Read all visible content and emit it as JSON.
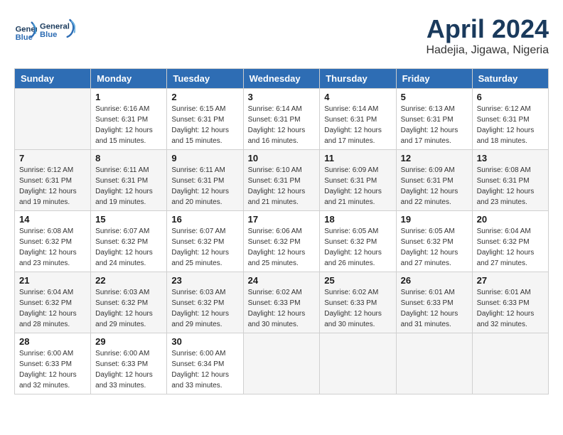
{
  "header": {
    "logo_line1": "General",
    "logo_line2": "Blue",
    "month": "April 2024",
    "location": "Hadejia, Jigawa, Nigeria"
  },
  "days_of_week": [
    "Sunday",
    "Monday",
    "Tuesday",
    "Wednesday",
    "Thursday",
    "Friday",
    "Saturday"
  ],
  "weeks": [
    [
      {
        "day": "",
        "sunrise": "",
        "sunset": "",
        "daylight": ""
      },
      {
        "day": "1",
        "sunrise": "Sunrise: 6:16 AM",
        "sunset": "Sunset: 6:31 PM",
        "daylight": "Daylight: 12 hours and 15 minutes."
      },
      {
        "day": "2",
        "sunrise": "Sunrise: 6:15 AM",
        "sunset": "Sunset: 6:31 PM",
        "daylight": "Daylight: 12 hours and 15 minutes."
      },
      {
        "day": "3",
        "sunrise": "Sunrise: 6:14 AM",
        "sunset": "Sunset: 6:31 PM",
        "daylight": "Daylight: 12 hours and 16 minutes."
      },
      {
        "day": "4",
        "sunrise": "Sunrise: 6:14 AM",
        "sunset": "Sunset: 6:31 PM",
        "daylight": "Daylight: 12 hours and 17 minutes."
      },
      {
        "day": "5",
        "sunrise": "Sunrise: 6:13 AM",
        "sunset": "Sunset: 6:31 PM",
        "daylight": "Daylight: 12 hours and 17 minutes."
      },
      {
        "day": "6",
        "sunrise": "Sunrise: 6:12 AM",
        "sunset": "Sunset: 6:31 PM",
        "daylight": "Daylight: 12 hours and 18 minutes."
      }
    ],
    [
      {
        "day": "7",
        "sunrise": "Sunrise: 6:12 AM",
        "sunset": "Sunset: 6:31 PM",
        "daylight": "Daylight: 12 hours and 19 minutes."
      },
      {
        "day": "8",
        "sunrise": "Sunrise: 6:11 AM",
        "sunset": "Sunset: 6:31 PM",
        "daylight": "Daylight: 12 hours and 19 minutes."
      },
      {
        "day": "9",
        "sunrise": "Sunrise: 6:11 AM",
        "sunset": "Sunset: 6:31 PM",
        "daylight": "Daylight: 12 hours and 20 minutes."
      },
      {
        "day": "10",
        "sunrise": "Sunrise: 6:10 AM",
        "sunset": "Sunset: 6:31 PM",
        "daylight": "Daylight: 12 hours and 21 minutes."
      },
      {
        "day": "11",
        "sunrise": "Sunrise: 6:09 AM",
        "sunset": "Sunset: 6:31 PM",
        "daylight": "Daylight: 12 hours and 21 minutes."
      },
      {
        "day": "12",
        "sunrise": "Sunrise: 6:09 AM",
        "sunset": "Sunset: 6:31 PM",
        "daylight": "Daylight: 12 hours and 22 minutes."
      },
      {
        "day": "13",
        "sunrise": "Sunrise: 6:08 AM",
        "sunset": "Sunset: 6:31 PM",
        "daylight": "Daylight: 12 hours and 23 minutes."
      }
    ],
    [
      {
        "day": "14",
        "sunrise": "Sunrise: 6:08 AM",
        "sunset": "Sunset: 6:32 PM",
        "daylight": "Daylight: 12 hours and 23 minutes."
      },
      {
        "day": "15",
        "sunrise": "Sunrise: 6:07 AM",
        "sunset": "Sunset: 6:32 PM",
        "daylight": "Daylight: 12 hours and 24 minutes."
      },
      {
        "day": "16",
        "sunrise": "Sunrise: 6:07 AM",
        "sunset": "Sunset: 6:32 PM",
        "daylight": "Daylight: 12 hours and 25 minutes."
      },
      {
        "day": "17",
        "sunrise": "Sunrise: 6:06 AM",
        "sunset": "Sunset: 6:32 PM",
        "daylight": "Daylight: 12 hours and 25 minutes."
      },
      {
        "day": "18",
        "sunrise": "Sunrise: 6:05 AM",
        "sunset": "Sunset: 6:32 PM",
        "daylight": "Daylight: 12 hours and 26 minutes."
      },
      {
        "day": "19",
        "sunrise": "Sunrise: 6:05 AM",
        "sunset": "Sunset: 6:32 PM",
        "daylight": "Daylight: 12 hours and 27 minutes."
      },
      {
        "day": "20",
        "sunrise": "Sunrise: 6:04 AM",
        "sunset": "Sunset: 6:32 PM",
        "daylight": "Daylight: 12 hours and 27 minutes."
      }
    ],
    [
      {
        "day": "21",
        "sunrise": "Sunrise: 6:04 AM",
        "sunset": "Sunset: 6:32 PM",
        "daylight": "Daylight: 12 hours and 28 minutes."
      },
      {
        "day": "22",
        "sunrise": "Sunrise: 6:03 AM",
        "sunset": "Sunset: 6:32 PM",
        "daylight": "Daylight: 12 hours and 29 minutes."
      },
      {
        "day": "23",
        "sunrise": "Sunrise: 6:03 AM",
        "sunset": "Sunset: 6:32 PM",
        "daylight": "Daylight: 12 hours and 29 minutes."
      },
      {
        "day": "24",
        "sunrise": "Sunrise: 6:02 AM",
        "sunset": "Sunset: 6:33 PM",
        "daylight": "Daylight: 12 hours and 30 minutes."
      },
      {
        "day": "25",
        "sunrise": "Sunrise: 6:02 AM",
        "sunset": "Sunset: 6:33 PM",
        "daylight": "Daylight: 12 hours and 30 minutes."
      },
      {
        "day": "26",
        "sunrise": "Sunrise: 6:01 AM",
        "sunset": "Sunset: 6:33 PM",
        "daylight": "Daylight: 12 hours and 31 minutes."
      },
      {
        "day": "27",
        "sunrise": "Sunrise: 6:01 AM",
        "sunset": "Sunset: 6:33 PM",
        "daylight": "Daylight: 12 hours and 32 minutes."
      }
    ],
    [
      {
        "day": "28",
        "sunrise": "Sunrise: 6:00 AM",
        "sunset": "Sunset: 6:33 PM",
        "daylight": "Daylight: 12 hours and 32 minutes."
      },
      {
        "day": "29",
        "sunrise": "Sunrise: 6:00 AM",
        "sunset": "Sunset: 6:33 PM",
        "daylight": "Daylight: 12 hours and 33 minutes."
      },
      {
        "day": "30",
        "sunrise": "Sunrise: 6:00 AM",
        "sunset": "Sunset: 6:34 PM",
        "daylight": "Daylight: 12 hours and 33 minutes."
      },
      {
        "day": "",
        "sunrise": "",
        "sunset": "",
        "daylight": ""
      },
      {
        "day": "",
        "sunrise": "",
        "sunset": "",
        "daylight": ""
      },
      {
        "day": "",
        "sunrise": "",
        "sunset": "",
        "daylight": ""
      },
      {
        "day": "",
        "sunrise": "",
        "sunset": "",
        "daylight": ""
      }
    ]
  ]
}
